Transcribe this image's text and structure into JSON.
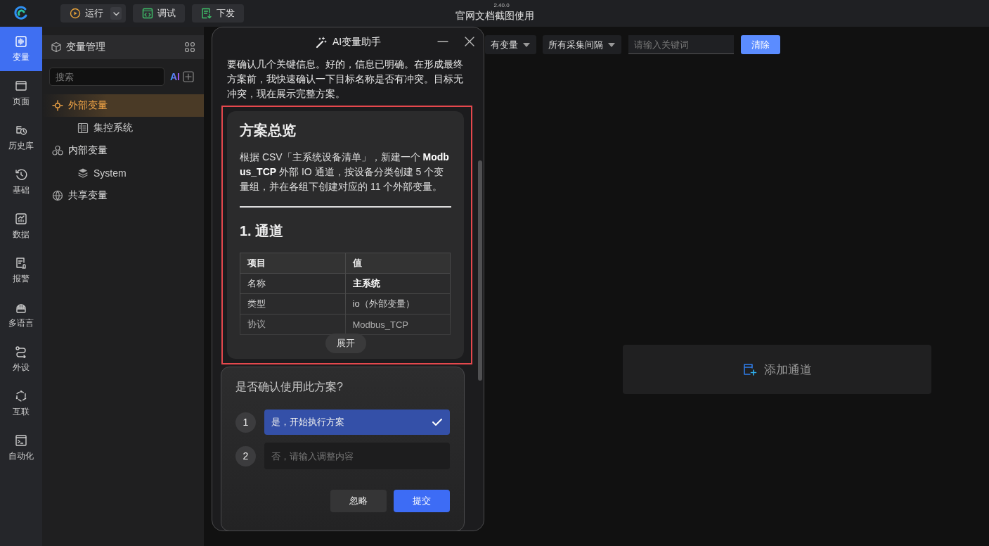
{
  "app": {
    "version": "2.40.0",
    "title": "官网文档截图使用"
  },
  "toolbar": [
    {
      "label": "运行",
      "kind": "split"
    },
    {
      "label": "调试",
      "kind": "debug"
    },
    {
      "label": "下发",
      "kind": "deploy"
    }
  ],
  "nav": [
    {
      "label": "变量",
      "kind": "variable",
      "selected": true
    },
    {
      "label": "页面",
      "kind": "page",
      "selected": false
    },
    {
      "label": "历史库",
      "kind": "history",
      "selected": false
    },
    {
      "label": "基础",
      "kind": "basic",
      "selected": false
    },
    {
      "label": "数据",
      "kind": "data",
      "selected": false
    },
    {
      "label": "报警",
      "kind": "alarm",
      "selected": false
    },
    {
      "label": "多语言",
      "kind": "language",
      "selected": false
    },
    {
      "label": "外设",
      "kind": "device",
      "selected": false
    },
    {
      "label": "互联",
      "kind": "link",
      "selected": false
    },
    {
      "label": "自动化",
      "kind": "auto",
      "selected": false
    }
  ],
  "variable_panel": {
    "title": "变量管理",
    "search": {
      "placeholder": "搜索"
    },
    "ai_label": "AI",
    "tree": [
      {
        "label": "外部变量",
        "kind": "external",
        "selected": true,
        "children": [
          {
            "label": "集控系统",
            "kind": "system",
            "selected": false
          }
        ]
      },
      {
        "label": "内部变量",
        "kind": "internal",
        "selected": false,
        "children": [
          {
            "label": "System",
            "kind": "layers",
            "selected": false
          }
        ]
      },
      {
        "label": "共享变量",
        "kind": "shared",
        "selected": false
      }
    ]
  },
  "filters": [
    {
      "label": "有变量"
    },
    {
      "label": "所有采集间隔"
    }
  ],
  "keyword": {
    "placeholder": "请输入关键词"
  },
  "clear_button": "清除",
  "add_channel": "添加通道",
  "assistant": {
    "title": "AI变量助手",
    "message": "要确认几个关键信息。好的，信息已明确。在形成最终方案前，我快速确认一下目标名称是否有冲突。目标无冲突，现在展示完整方案。",
    "plan": {
      "highlighted": true,
      "title": "方案总览",
      "summary": "根据 CSV「主系统设备清单」，新建一个 **Modbus_TCP** 外部 IO 通道，按设备分类创建 5 个变量组，并在各组下创建对应的 11 个外部变量。",
      "section": "1. 通道",
      "columns": [
        "项目",
        "值"
      ],
      "rows": [
        {
          "item": "名称",
          "value": "主系统",
          "bold": true
        },
        {
          "item": "类型",
          "value": "io（外部变量）",
          "bold": false
        },
        {
          "item": "协议",
          "value": "Modbus_TCP",
          "bold": false
        }
      ],
      "expand": "展开"
    },
    "confirm": {
      "question": "是否确认使用此方案?",
      "options": [
        {
          "number": "1",
          "kind": "choice",
          "label": "是，开始执行方案",
          "selected": true
        },
        {
          "number": "2",
          "kind": "input",
          "placeholder": "否，请输入调整内容",
          "selected": false
        }
      ],
      "buttons": [
        {
          "label": "忽略",
          "kind": "secondary"
        },
        {
          "label": "提交",
          "kind": "primary"
        }
      ]
    }
  }
}
